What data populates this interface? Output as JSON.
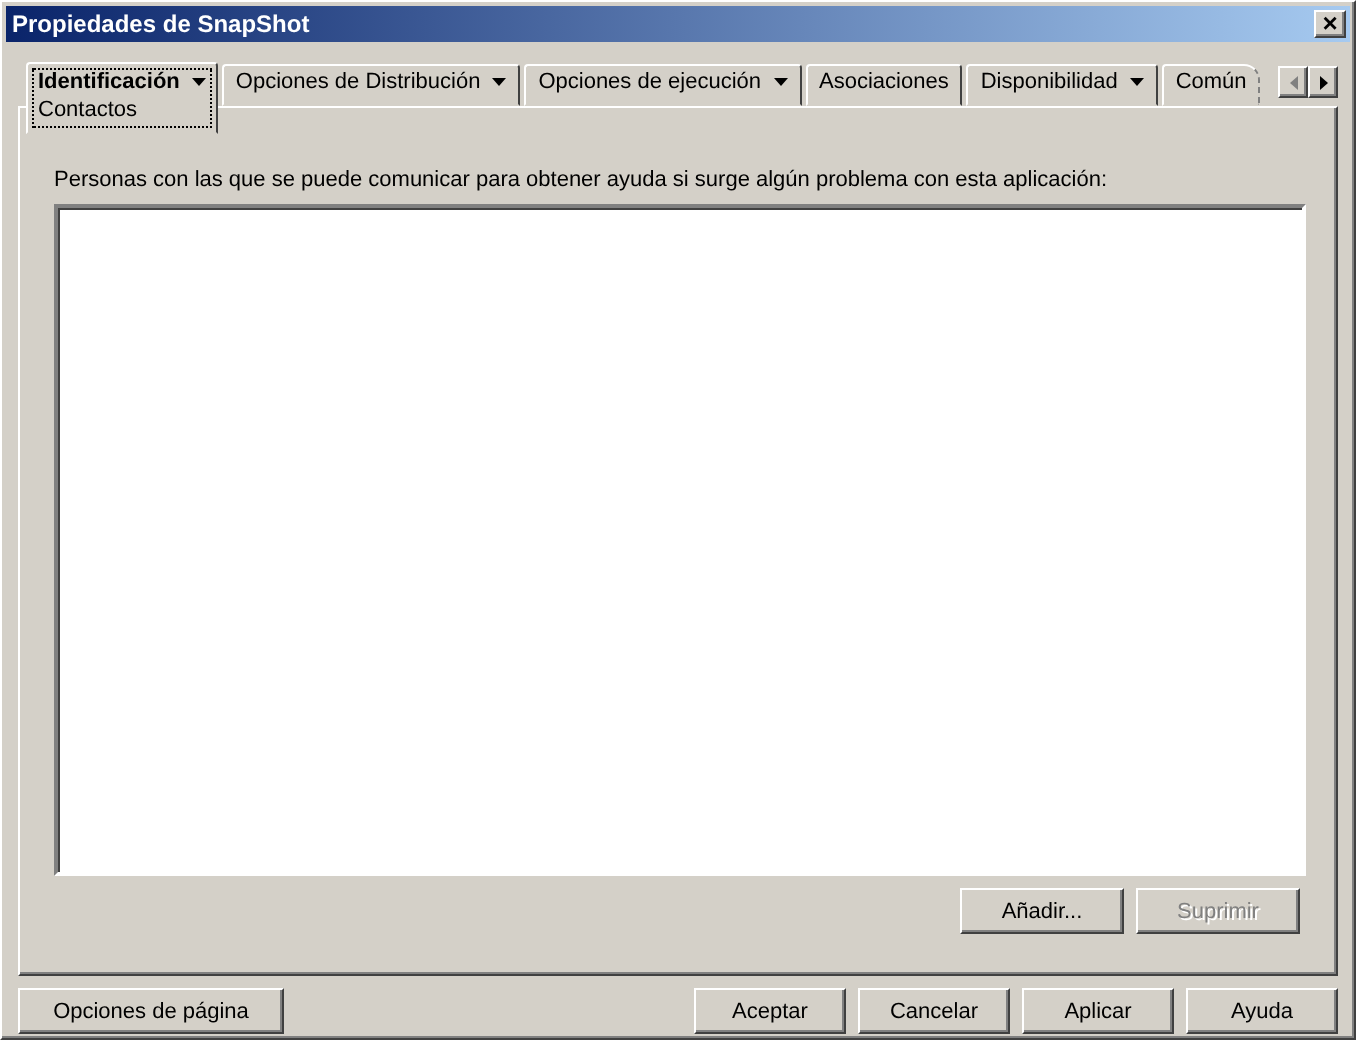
{
  "window": {
    "title": "Propiedades de SnapShot",
    "close": "×"
  },
  "tabs": [
    {
      "label": "Identificación",
      "subtitle": "Contactos",
      "dropdown": true,
      "selected": true,
      "cut": false
    },
    {
      "label": "Opciones de Distribución",
      "dropdown": true,
      "selected": false,
      "cut": false
    },
    {
      "label": "Opciones de ejecución",
      "dropdown": true,
      "selected": false,
      "cut": false
    },
    {
      "label": "Asociaciones",
      "dropdown": false,
      "selected": false,
      "cut": false
    },
    {
      "label": "Disponibilidad",
      "dropdown": true,
      "selected": false,
      "cut": false
    },
    {
      "label": "Común",
      "dropdown": false,
      "selected": false,
      "cut": true
    }
  ],
  "tab_scroll": {
    "left_disabled": true,
    "right_disabled": false
  },
  "panel": {
    "label": "Personas con las que se puede comunicar para obtener ayuda si surge algún problema con esta aplicación:",
    "buttons": [
      {
        "label": "Añadir...",
        "disabled": false
      },
      {
        "label": "Suprimir",
        "disabled": true
      }
    ]
  },
  "footer": {
    "left_button": "Opciones de página",
    "buttons": [
      "Aceptar",
      "Cancelar",
      "Aplicar",
      "Ayuda"
    ]
  }
}
